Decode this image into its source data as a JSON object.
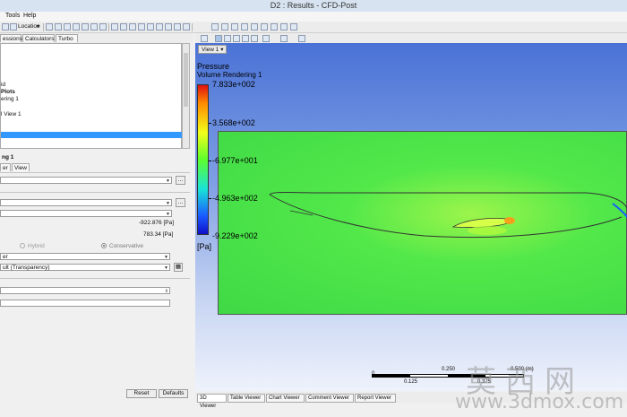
{
  "window": {
    "title": "D2 : Results - CFD-Post"
  },
  "menu": {
    "items": [
      "Tools",
      "Help"
    ]
  },
  "toolbar": {
    "location_label": "Location"
  },
  "left_tabs": [
    "essions",
    "Calculators",
    "Turbo"
  ],
  "tree": {
    "items": [
      "id",
      "Plots",
      "ering 1",
      "l View 1"
    ]
  },
  "details": {
    "title": "ng 1",
    "tabs": [
      "er",
      "View"
    ],
    "min_value": "-922.876 [Pa]",
    "max_value": "783.34 [Pa]",
    "radio_hybrid": "Hybrid",
    "radio_conservative": "Conservative",
    "combo_color_mode": "er",
    "combo_transparency": "ult (Transparency)",
    "reset_label": "Reset",
    "defaults_label": "Defaults"
  },
  "viewer": {
    "view_label": "View 1",
    "bottom_tabs": [
      "3D Viewer",
      "Table Viewer",
      "Chart Viewer",
      "Comment Viewer",
      "Report Viewer"
    ]
  },
  "legend": {
    "variable": "Pressure",
    "object": "Volume Rendering 1",
    "values": [
      "7.833e+002",
      "3.568e+002",
      "-6.977e+001",
      "-4.963e+002",
      "-9.229e+002"
    ],
    "unit": "[Pa]",
    "colors": {
      "top": "#e01010",
      "middle": "#5dff2c",
      "bottom": "#1010c9"
    }
  },
  "scale": {
    "labels_top": [
      "0",
      "0.250",
      "0.500 (m)"
    ],
    "labels_bottom": [
      "0.125",
      "0.375"
    ]
  },
  "watermark": {
    "text_cn": "莫西网",
    "text_url": "www.3dmox.com"
  }
}
